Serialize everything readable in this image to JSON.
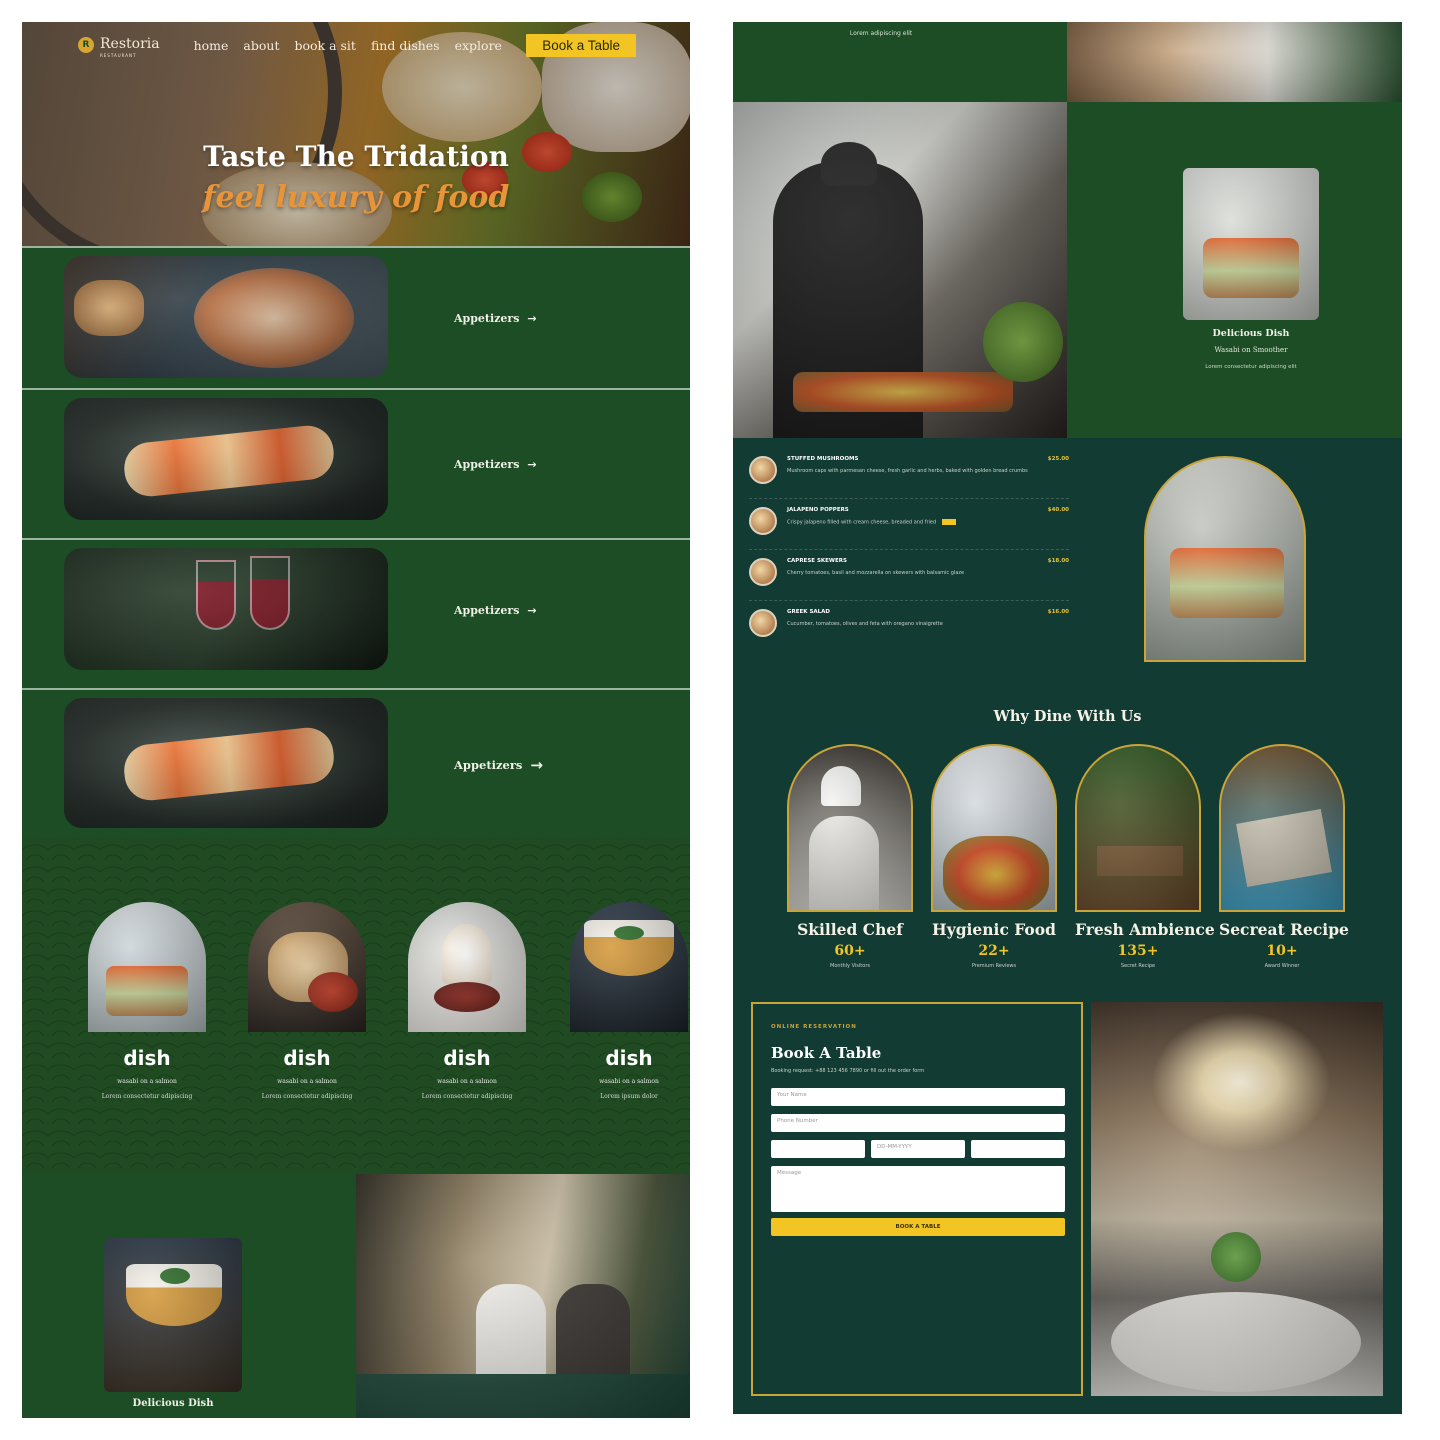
{
  "nav": {
    "logo_mark": "R",
    "logo_name": "Restoria",
    "logo_tagline": "RESTAURANT",
    "links": [
      "home",
      "about",
      "book a sit",
      "find dishes",
      "explore"
    ],
    "cta": "Book a Table"
  },
  "hero": {
    "title": "Taste The Tridation",
    "subtitle": "feel luxury of food"
  },
  "categories": [
    {
      "label": "Appetizers",
      "arrow": "→"
    },
    {
      "label": "Appetizers",
      "arrow": "→"
    },
    {
      "label": "Appetizers",
      "arrow": "→"
    },
    {
      "label": "Appetizers",
      "arrow": "→"
    }
  ],
  "dishes": [
    {
      "name": "dish",
      "sub": "wasabi on a salmon",
      "desc": "Lorem consectetur adipiscing"
    },
    {
      "name": "dish",
      "sub": "wasabi on a salmon",
      "desc": "Lorem consectetur adipiscing"
    },
    {
      "name": "dish",
      "sub": "wasabi on a salmon",
      "desc": "Lorem consectetur adipiscing"
    },
    {
      "name": "dish",
      "sub": "wasabi on a salmon",
      "desc": "Lorem ipsum dolor"
    }
  ],
  "bottom_dish_label": "Delicious Dish",
  "right_top_text": "Lorem adipiscing elit",
  "featured": {
    "title": "Delicious Dish",
    "sub": "Wasabi on Smoother",
    "desc": "Lorem consectetur adipiscing elit"
  },
  "menu": [
    {
      "name": "STUFFED MUSHROOMS",
      "price": "$25.00",
      "desc": "Mushroom caps with parmesan cheese, fresh garlic and herbs, baked with golden bread crumbs"
    },
    {
      "name": "JALAPENO POPPERS",
      "price": "$40.00",
      "desc": "Crispy jalapeno filled with cream cheese, breaded and fried",
      "badge": true
    },
    {
      "name": "CAPRESE SKEWERS",
      "price": "$18.00",
      "desc": "Cherry tomatoes, basil and mozzarella on skewers with balsamic glaze"
    },
    {
      "name": "GREEK SALAD",
      "price": "$16.00",
      "desc": "Cucumber, tomatoes, olives and feta with oregano vinaigrette"
    }
  ],
  "why": {
    "title": "Why Dine With Us",
    "items": [
      {
        "name": "Skilled Chef",
        "num": "60+",
        "label": "Monthly Visitors"
      },
      {
        "name": "Hygienic Food",
        "num": "22+",
        "label": "Premium Reviews"
      },
      {
        "name": "Fresh Ambience",
        "num": "135+",
        "label": "Secret Recipe"
      },
      {
        "name": "Secreat Recipe",
        "num": "10+",
        "label": "Award Winner"
      }
    ]
  },
  "booking": {
    "kicker": "ONLINE RESERVATION",
    "title": "Book A Table",
    "note": "Booking request: +88 123 456 7890 or fill out the order form",
    "name_placeholder": "Your Name",
    "phone_placeholder": "Phone Number",
    "date_placeholder": "DD-MM-YYYY",
    "message_placeholder": "Message",
    "submit": "BOOK A TABLE"
  },
  "colors": {
    "left_bg": "#1d4d24",
    "right_bg": "#123b33",
    "accent": "#f2c524",
    "gold": "#c8a43a",
    "hero_sub": "#e8953a"
  }
}
